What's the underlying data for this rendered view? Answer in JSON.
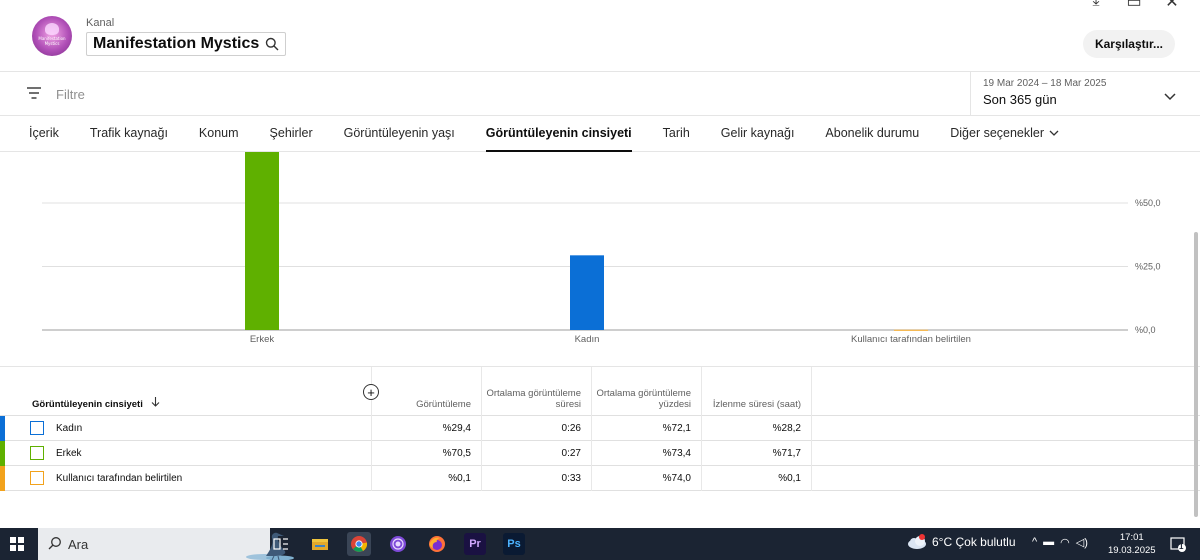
{
  "header": {
    "kanal_label": "Kanal",
    "channel_name": "Manifestation Mystics",
    "avatar_text": "Manifestation Mystics",
    "compare_button": "Karşılaştır..."
  },
  "filterbar": {
    "filter_label": "Filtre",
    "date_range": "19 Mar 2024 – 18 Mar 2025",
    "date_period": "Son 365 gün"
  },
  "tabs": [
    {
      "label": "İçerik"
    },
    {
      "label": "Trafik kaynağı"
    },
    {
      "label": "Konum"
    },
    {
      "label": "Şehirler"
    },
    {
      "label": "Görüntüleyenin yaşı"
    },
    {
      "label": "Görüntüleyenin cinsiyeti",
      "active": true
    },
    {
      "label": "Tarih"
    },
    {
      "label": "Gelir kaynağı"
    },
    {
      "label": "Abonelik durumu"
    },
    {
      "label": "Diğer seçenekler"
    }
  ],
  "chart_data": {
    "type": "bar",
    "categories": [
      "Erkek",
      "Kadın",
      "Kullanıcı tarafından belirtilen"
    ],
    "values": [
      70.5,
      29.4,
      0.1
    ],
    "colors": [
      "#5fb000",
      "#0b6fd6",
      "#f2a21c"
    ],
    "y_ticks": [
      "%0,0",
      "%25,0",
      "%50,0"
    ],
    "y_tick_values": [
      0,
      25,
      50
    ],
    "ylim": [
      0,
      50
    ],
    "grid": true
  },
  "table": {
    "headers": {
      "dimension": "Görüntüleyenin cinsiyeti",
      "views": "Görüntüleme",
      "avg_duration": "Ortalama görüntüleme süresi",
      "avg_percent": "Ortalama görüntüleme yüzdesi",
      "watch_time": "İzlenme süresi (saat)"
    },
    "rows": [
      {
        "label": "Kadın",
        "color": "#0b6fd6",
        "views": "%29,4",
        "avg_duration": "0:26",
        "avg_percent": "%72,1",
        "watch_time": "%28,2"
      },
      {
        "label": "Erkek",
        "color": "#5fb000",
        "views": "%70,5",
        "avg_duration": "0:27",
        "avg_percent": "%73,4",
        "watch_time": "%71,7"
      },
      {
        "label": "Kullanıcı tarafından belirtilen",
        "color": "#f2a21c",
        "views": "%0,1",
        "avg_duration": "0:33",
        "avg_percent": "%74,0",
        "watch_time": "%0,1"
      }
    ]
  },
  "taskbar": {
    "search_placeholder": "Ara",
    "apps": [
      {
        "name": "task-view-icon",
        "label": ""
      },
      {
        "name": "file-explorer-icon",
        "label": ""
      },
      {
        "name": "chrome-icon",
        "label": ""
      },
      {
        "name": "tor-browser-icon",
        "label": ""
      },
      {
        "name": "firefox-icon",
        "label": ""
      },
      {
        "name": "premiere-pro-icon",
        "label": "Pr"
      },
      {
        "name": "photoshop-icon",
        "label": "Ps"
      }
    ],
    "weather": "6°C  Çok bulutlu",
    "time": "17:01",
    "date": "19.03.2025",
    "notification_count": "1"
  }
}
